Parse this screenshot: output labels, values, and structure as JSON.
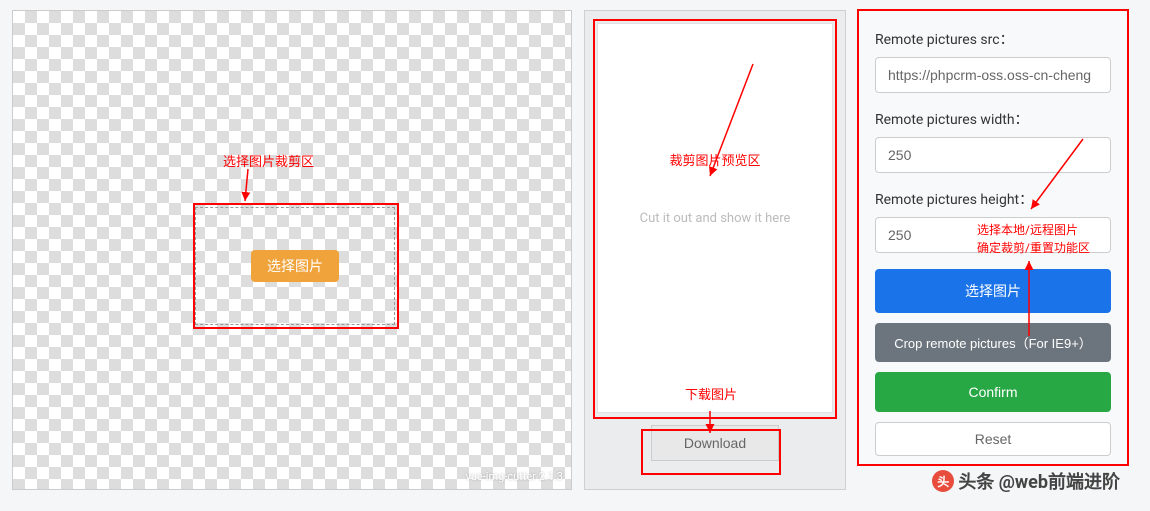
{
  "crop_area": {
    "choose_button": "选择图片",
    "watermark": "vue-img-cutter 2.1.3",
    "annotation_label": "选择图片裁剪区"
  },
  "preview": {
    "annotation_label": "裁剪图片预览区",
    "placeholder_text": "Cut it out and show it here",
    "download_button": "Download",
    "download_annotation": "下载图片"
  },
  "form": {
    "src_label": "Remote pictures src：",
    "src_value": "https://phpcrm-oss.oss-cn-cheng",
    "width_label": "Remote pictures width：",
    "width_value": "250",
    "height_label": "Remote pictures height：",
    "height_value": "250",
    "annotation_line1": "选择本地/远程图片",
    "annotation_line2": "确定裁剪/重置功能区",
    "select_button": "选择图片",
    "crop_remote_button": "Crop remote pictures（For IE9+）",
    "confirm_button": "Confirm",
    "reset_button": "Reset"
  },
  "footer_watermark": "头条 @web前端进阶"
}
